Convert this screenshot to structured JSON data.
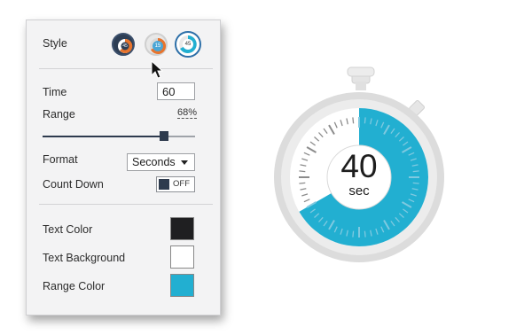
{
  "panel": {
    "style_label": "Style",
    "style_options": [
      {
        "label": "45",
        "name": "style-option-1"
      },
      {
        "label": "15",
        "name": "style-option-2"
      },
      {
        "label": "45",
        "name": "style-option-3"
      }
    ],
    "time_label": "Time",
    "time_value": "60",
    "range_label": "Range",
    "range_value": "68%",
    "range_fraction": 0.68,
    "format_label": "Format",
    "format_value": "Seconds",
    "count_down_label": "Count Down",
    "count_down_state": "OFF",
    "text_color_label": "Text Color",
    "text_background_label": "Text Background",
    "range_color_label": "Range Color"
  },
  "colors": {
    "text_color": "#1f1f21",
    "text_background": "#ffffff",
    "range_color": "#22afd1",
    "accent_dark": "#2e3b4e"
  },
  "timer": {
    "value": "40",
    "unit": "sec",
    "remaining_fraction": 0.667
  }
}
